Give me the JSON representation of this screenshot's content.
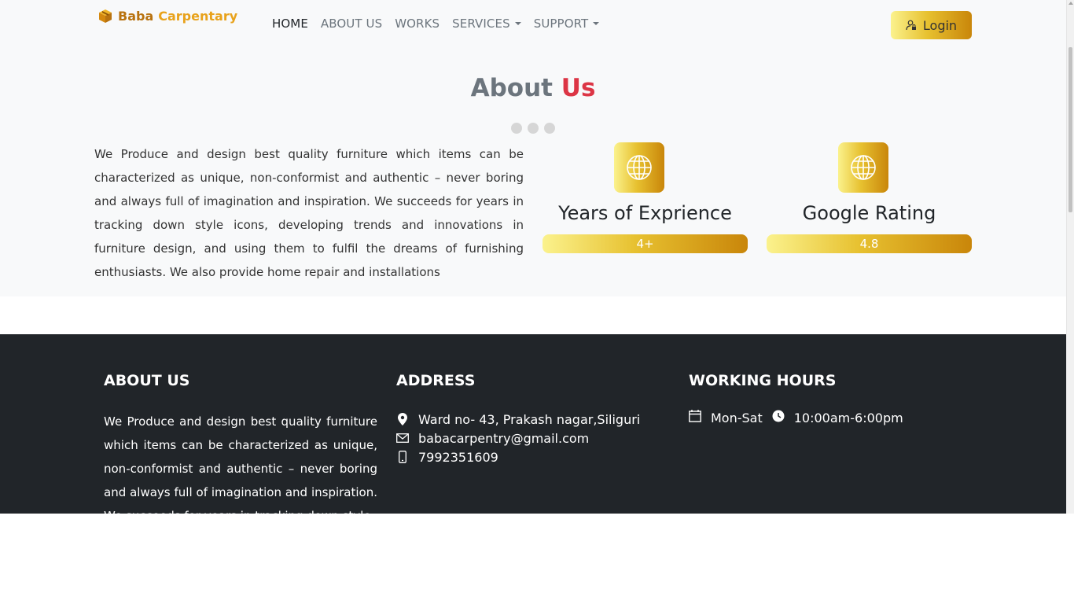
{
  "brand": {
    "part1": "Baba",
    "part2": "Carpentary"
  },
  "nav": {
    "items": [
      {
        "label": "HOME"
      },
      {
        "label": "ABOUT US"
      },
      {
        "label": "WORKS"
      },
      {
        "label": "SERVICES"
      },
      {
        "label": "SUPPORT"
      }
    ],
    "login_label": "Login"
  },
  "about": {
    "title_part1": "About",
    "title_part2": "Us",
    "text": "We Produce and design best quality furniture which items can be characterized as unique, non-conformist and authentic – never boring and always full of imagination and inspiration. We succeeds for years in tracking down style icons, developing trends and innovations in furniture design, and using them to fulfil the dreams of furnishing enthusiasts. We also provide home repair and installations",
    "stats": [
      {
        "label": "Years of Exprience",
        "value": "4+",
        "icon": "globe-icon"
      },
      {
        "label": "Google Rating",
        "value": "4.8",
        "icon": "globe-icon"
      }
    ]
  },
  "footer": {
    "about_heading": "ABOUT US",
    "about_text": "We Produce and design best quality furniture which items can be characterized as unique, non-conformist and authentic – never boring and always full of imagination and inspiration. We succeeds for years in tracking down style",
    "address_heading": "ADDRESS",
    "address": "Ward no- 43, Prakash nagar,Siliguri",
    "email": "babacarpentry@gmail.com",
    "phone": "7992351609",
    "hours_heading": "WORKING HOURS",
    "days": "Mon-Sat",
    "hours": "10:00am-6:00pm"
  },
  "colors": {
    "accent_gold_light": "#fbf28d",
    "accent_gold_dark": "#c9860a",
    "title_red": "#dc3545",
    "footer_bg": "#212529"
  }
}
